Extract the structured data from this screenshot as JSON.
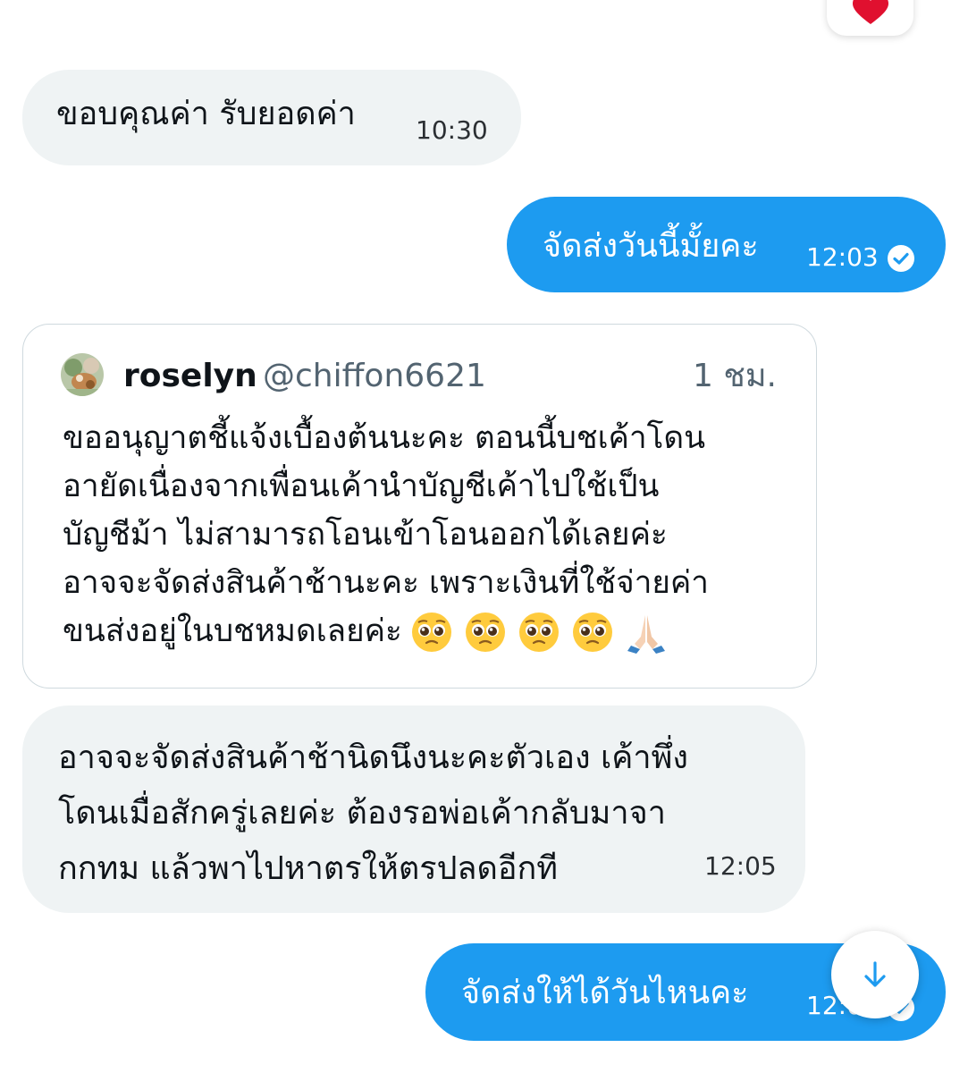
{
  "reaction": {
    "icon": "heart-icon",
    "color": "#f91880"
  },
  "messages": [
    {
      "direction": "incoming",
      "text": "ขอบคุณค่า รับยอดค่า",
      "time": "10:30"
    },
    {
      "direction": "outgoing",
      "text": "จัดส่งวันนี้มั้ยคะ",
      "time": "12:03",
      "status_icon": "read-check-icon"
    },
    {
      "type": "quoted_tweet",
      "author_name": "roselyn",
      "author_handle": "@chiffon6621",
      "time_ago": "1 ชม.",
      "body_lines": [
        "ขออนุญาตชี้แจ้งเบื้องต้นนะคะ ตอนนี้บชเค้าโดน",
        "อายัดเนื่องจากเพื่อนเค้านำบัญชีเค้าไปใช้เป็น",
        "บัญชีม้า ไม่สามารถโอนเข้าโอนออกได้เลยค่ะ",
        "อาจจะจัดส่งสินค้าช้านะคะ เพราะเงินที่ใช้จ่ายค่า",
        "ขนส่งอยู่ในบชหมดเลยค่ะ"
      ],
      "emojis": [
        "pleading-face-icon",
        "pleading-face-icon",
        "pleading-face-icon",
        "pleading-face-icon",
        "folded-hands-icon"
      ]
    },
    {
      "direction": "incoming",
      "text_lines": [
        "อาจจะจัดส่งสินค้าช้านิดนึงนะคะตัวเอง เค้าพึ่ง",
        "โดนเมื่อสักครู่เลยค่ะ ต้องรอพ่อเค้ากลับมาจา",
        "กกทม แล้วพาไปหาตรให้ตรปลดอีกที"
      ],
      "time": "12:05"
    },
    {
      "direction": "outgoing",
      "text": "จัดส่งให้ได้วันไหนคะ",
      "time": "12:0",
      "status_icon": "read-check-icon"
    }
  ],
  "scroll_button": {
    "icon": "arrow-down-icon"
  },
  "colors": {
    "outgoing_bubble": "#1d9bf0",
    "incoming_bubble": "#eff3f4",
    "accent": "#1d9bf0"
  }
}
